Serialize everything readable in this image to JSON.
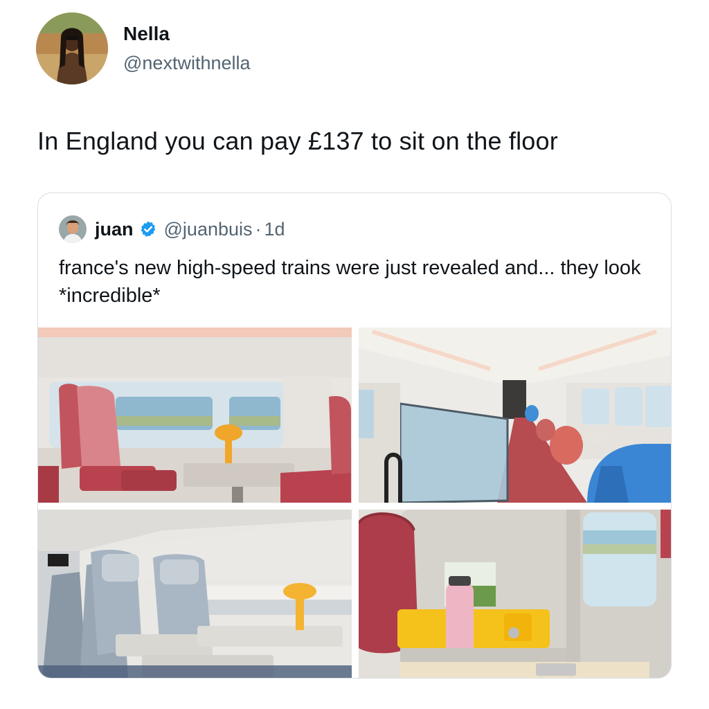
{
  "tweet": {
    "author": {
      "name": "Nella",
      "handle": "@nextwithnella"
    },
    "text": "In England you can pay £137 to sit on the floor"
  },
  "quoted_tweet": {
    "author": {
      "name": "juan",
      "handle": "@juanbuis",
      "verified": true
    },
    "separator": "·",
    "time": "1d",
    "text": "france's new high-speed trains were just revealed and... they look *incredible*",
    "photos": [
      {
        "name": "train-interior-red-seats"
      },
      {
        "name": "train-interior-aisle-lounge"
      },
      {
        "name": "train-interior-grey-seats"
      },
      {
        "name": "train-seat-detail-cap-bottle"
      }
    ]
  },
  "colors": {
    "text": "#0f1419",
    "secondary": "#536471",
    "verified": "#1d9bf0",
    "border": "#d9dee2"
  },
  "icons": {
    "verified": "verified-badge-icon"
  }
}
